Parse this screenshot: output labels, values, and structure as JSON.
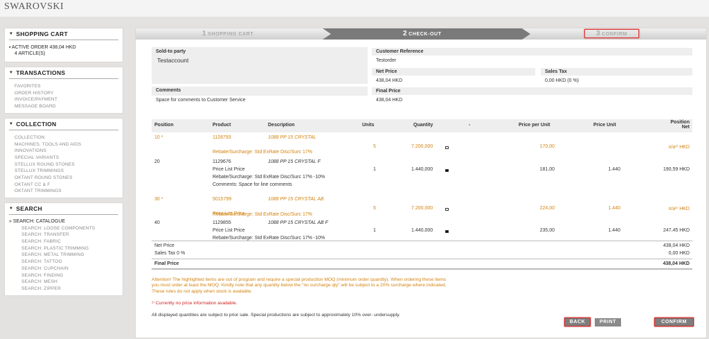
{
  "brand": "SWAROVSKI",
  "sidebar": {
    "cart": {
      "title": "SHOPPING CART",
      "active_order": "ACTIVE ORDER 438,04 HKD",
      "articles": "4 ARTICLE(S)"
    },
    "transactions": {
      "title": "TRANSACTIONS",
      "items": [
        "FAVORITES",
        "ORDER HISTORY",
        "INVOICE/PAYMENT",
        "MESSAGE BOARD"
      ]
    },
    "collection": {
      "title": "COLLECTION",
      "items": [
        "COLLECTION",
        "MACHINES, TOOLS AND AIDS",
        "INNOVATIONS",
        "SPECIAL VARIANTS",
        "STELLUX ROUND STONES",
        "STELLUX TRIMMINGS",
        "OKTANT ROUND STONES",
        "OKTANT CC & F",
        "OKTANT TRIMMINGS"
      ]
    },
    "search": {
      "title": "SEARCH",
      "catalogue": "SEARCH: CATALOGUE",
      "items": [
        "SEARCH: LOOSE COMPONENTS",
        "SEARCH: TRANSFER",
        "SEARCH: FABRIC",
        "SEARCH: PLASTIC TRIMMING",
        "SEARCH: METAL TRIMMING",
        "SEARCH: TATTOO",
        "SEARCH: CUPCHAIN",
        "SEARCH: FINDING",
        "SEARCH: MESH",
        "SEARCH: ZIPPER"
      ]
    }
  },
  "steps": [
    {
      "num": "1",
      "label": "SHOPPING CART"
    },
    {
      "num": "2",
      "label": "CHECK-OUT"
    },
    {
      "num": "3",
      "label": "CONFIRM"
    }
  ],
  "info": {
    "sold_to_label": "Sold-to party",
    "sold_to_value": "Testaccount",
    "comments_label": "Comments",
    "comments_value": "Space for comments to Customer Service",
    "cust_ref_label": "Customer Reference",
    "cust_ref_value": "Testorder",
    "net_price_label": "Net Price",
    "net_price_value": "438,04 HKD",
    "sales_tax_label": "Sales Tax",
    "sales_tax_value": "0,00 HKD (0 %)",
    "final_price_label": "Final Price",
    "final_price_value": "438,04 HKD"
  },
  "table": {
    "headers": {
      "position": "Position",
      "product": "Product",
      "description": "Description",
      "units": "Units",
      "quantity": "Quantity",
      "dash": "-",
      "price_per_unit": "Price per Unit",
      "price_unit": "Price Unit",
      "position_net_1": "Position",
      "position_net_2": "Net"
    },
    "rows": [
      {
        "position": "10 *",
        "product": "1128793",
        "description": "1088 PP 15 CRYSTAL",
        "units": "5",
        "quantity": "7.200,000",
        "price_per_unit": "170,00",
        "price_unit": "",
        "net": "n/a¹⁾ HKD",
        "line2": "Rebate/Surcharge:  Std ExRate Disc/Surc  17%",
        "line3": "",
        "line4": ""
      },
      {
        "position": "20",
        "product": "1129676",
        "description": "1088 PP 15 CRYSTAL F",
        "units": "1",
        "quantity": "1.440,000",
        "price_per_unit": "181,00",
        "price_unit": "1.440",
        "net": "190,59 HKD",
        "line2": "Price List Price",
        "line3": "Rebate/Surcharge:  Std ExRate Disc/Surc  17%  -10%",
        "line4": "Comments: Space for line comments"
      },
      {
        "position": "30 *",
        "product": "5015799",
        "description": "1088 PP 15 CRYSTAL AB",
        "units": "5",
        "quantity": "7.200,000",
        "price_per_unit": "224,00",
        "price_unit": "1.440",
        "net": "n/a¹⁾ HKD",
        "line2": "Price List Price",
        "line3": "Rebate/Surcharge:  Std ExRate Disc/Surc  17%",
        "line4": ""
      },
      {
        "position": "40",
        "product": "1129855",
        "description": "1088 PP 15 CRYSTAL AB F",
        "units": "1",
        "quantity": "1.440,000",
        "price_per_unit": "235,00",
        "price_unit": "1.440",
        "net": "247,45 HKD",
        "line2": "Price List Price",
        "line3": "Rebate/Surcharge:  Std ExRate Disc/Surc  17%  -10%",
        "line4": ""
      }
    ],
    "totals": {
      "net_label": "Net Price",
      "net_value": "438,04 HKD",
      "tax_label": "Sales Tax 0 %",
      "tax_value": "0,00 HKD",
      "final_label": "Final Price",
      "final_value": "438,04 HKD"
    }
  },
  "notes": {
    "attention_1": "Attention! The highlighted items are out of program and require a special production MOQ (minimum order quantity). When ordering these items",
    "attention_2": "you must order at least the MOQ. Kindly note that any quantity below the \"no surcharge qty\" will be subject to a 20% surcharge where indicated.",
    "attention_3": "These rules do not apply when stock is available.",
    "footnote": "¹⁾ Currently no price information available.",
    "disclaimer": "All displayed quantities are subject to prior sale.  Special productions are subject to approximately 10% over- undersupply."
  },
  "buttons": {
    "back": "BACK",
    "print": "PRINT",
    "confirm": "CONFIRM"
  },
  "colors": {
    "accent_orange": "#d2820e",
    "highlight_red": "#cc2222"
  }
}
